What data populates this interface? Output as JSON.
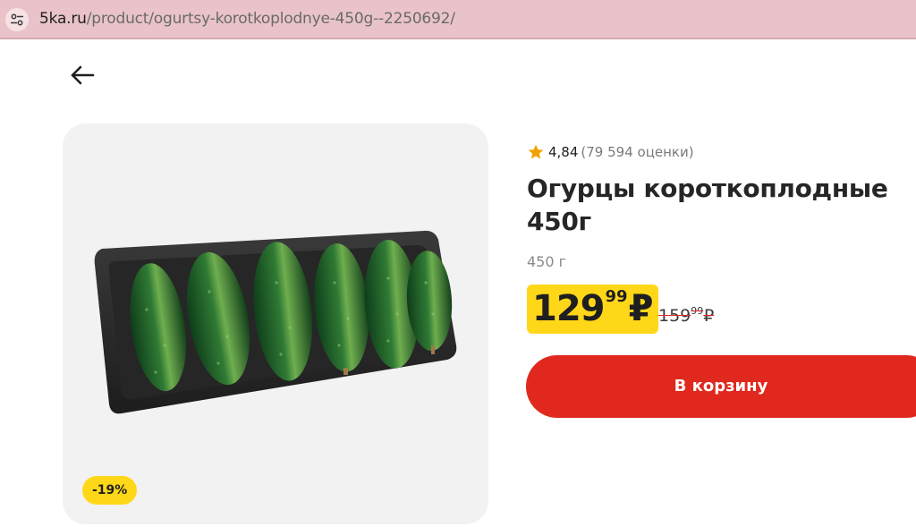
{
  "browser": {
    "url_domain": "5ka.ru",
    "url_path": "/product/ogurtsy-korotkoplodnye-450g--2250692/"
  },
  "product": {
    "discount_badge": "-19%",
    "rating": {
      "score": "4,84",
      "count": "(79 594 оценки)",
      "icon": "star-icon",
      "color": "#f2a200"
    },
    "title": "Огурцы короткоплодные 450г",
    "weight": "450 г",
    "price": {
      "rubles": "129",
      "kopecks": "99",
      "currency": "₽",
      "highlight_color": "#ffd719"
    },
    "old_price": {
      "rubles": "159",
      "kopecks": "99",
      "currency": "₽"
    },
    "add_to_cart_label": "В корзину",
    "button_color": "#e0281e"
  },
  "navigation": {
    "back_icon": "arrow-left-icon"
  }
}
